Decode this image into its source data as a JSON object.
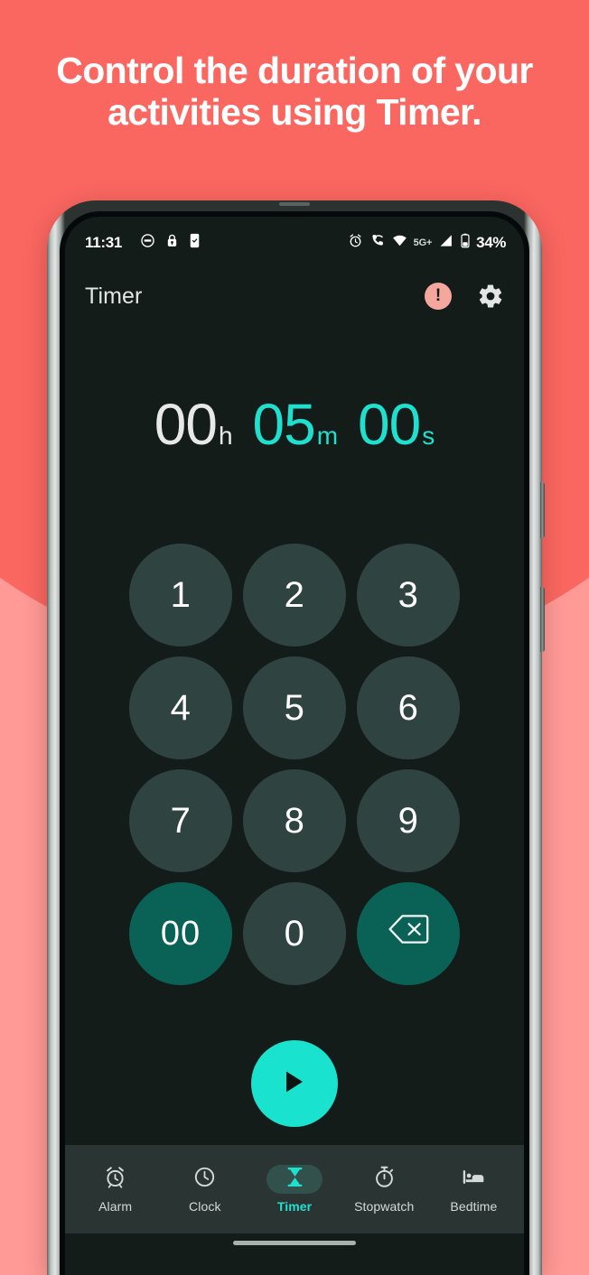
{
  "promo": {
    "headline": "Control the duration of your activities using Timer.",
    "bg_top_color": "#FA6761",
    "bg_bottom_color": "#FF9A97",
    "headline_color": "#FFFFFF"
  },
  "status_bar": {
    "time": "11:31",
    "left_icons": [
      "face-icon",
      "lock-icon",
      "device-icon"
    ],
    "right_icons": [
      "alarm-icon",
      "wifi-calling-icon",
      "wifi-icon"
    ],
    "network_label": "5G+",
    "signal_icon": "signal-bars-icon",
    "battery_icon": "battery-icon",
    "battery_percent": "34%"
  },
  "app_bar": {
    "title": "Timer",
    "alert_badge": "!",
    "alert_badge_color": "#F6A79D",
    "settings_icon": "gear-icon"
  },
  "timer_display": {
    "accent_color": "#1FE0CE",
    "inactive_color": "#E6E9E7",
    "segments": [
      {
        "value": "00",
        "unit": "h",
        "active": false
      },
      {
        "value": "05",
        "unit": "m",
        "active": true
      },
      {
        "value": "00",
        "unit": "s",
        "active": true
      }
    ]
  },
  "keypad": {
    "key_color": "#2F4441",
    "accent_key_color": "#0A6257",
    "keys": [
      {
        "label": "1",
        "name": "key-1",
        "accent": false
      },
      {
        "label": "2",
        "name": "key-2",
        "accent": false
      },
      {
        "label": "3",
        "name": "key-3",
        "accent": false
      },
      {
        "label": "4",
        "name": "key-4",
        "accent": false
      },
      {
        "label": "5",
        "name": "key-5",
        "accent": false
      },
      {
        "label": "6",
        "name": "key-6",
        "accent": false
      },
      {
        "label": "7",
        "name": "key-7",
        "accent": false
      },
      {
        "label": "8",
        "name": "key-8",
        "accent": false
      },
      {
        "label": "9",
        "name": "key-9",
        "accent": false
      },
      {
        "label": "00",
        "name": "key-double-zero",
        "accent": true
      },
      {
        "label": "0",
        "name": "key-0",
        "accent": false
      },
      {
        "label": "",
        "name": "key-backspace",
        "accent": true,
        "icon": "backspace-icon"
      }
    ]
  },
  "start_button": {
    "icon": "play-icon",
    "color": "#19E3CE"
  },
  "bottom_nav": {
    "active_color": "#1FE0CE",
    "items": [
      {
        "label": "Alarm",
        "icon": "alarm-clock-icon",
        "active": false
      },
      {
        "label": "Clock",
        "icon": "clock-icon",
        "active": false
      },
      {
        "label": "Timer",
        "icon": "hourglass-icon",
        "active": true
      },
      {
        "label": "Stopwatch",
        "icon": "stopwatch-icon",
        "active": false
      },
      {
        "label": "Bedtime",
        "icon": "bed-icon",
        "active": false
      }
    ]
  },
  "gesture_bar": {
    "name": "home-gesture-bar"
  }
}
